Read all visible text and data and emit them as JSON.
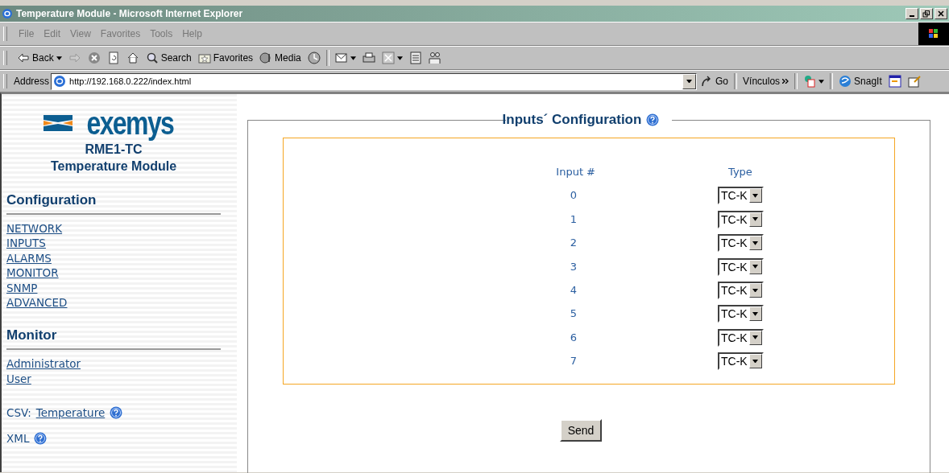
{
  "window": {
    "title": "Temperature Module - Microsoft Internet Explorer"
  },
  "menu": [
    "File",
    "Edit",
    "View",
    "Favorites",
    "Tools",
    "Help"
  ],
  "toolbar": [
    {
      "kind": "back",
      "label": "Back"
    },
    {
      "kind": "forward"
    },
    {
      "kind": "stop"
    },
    {
      "kind": "refresh"
    },
    {
      "kind": "home"
    },
    {
      "kind": "search",
      "label": "Search"
    },
    {
      "kind": "favorites",
      "label": "Favorites"
    },
    {
      "kind": "media",
      "label": "Media"
    },
    {
      "kind": "history"
    }
  ],
  "address_bar": {
    "label": "Address",
    "value": "http://192.168.0.222/index.html",
    "go": "Go",
    "links": "Vínculos",
    "snagit": "SnagIt"
  },
  "sidebar": {
    "logo": "exemys",
    "model": "RME1-TC",
    "subtitle": "Temperature Module",
    "sections": [
      {
        "title": "Configuration",
        "links": [
          "NETWORK",
          "INPUTS",
          "ALARMS",
          "MONITOR",
          "SNMP",
          "ADVANCED"
        ]
      },
      {
        "title": "Monitor",
        "links": [
          "Administrator",
          "User"
        ]
      }
    ],
    "exports": [
      {
        "label": "CSV:",
        "link": "Temperature"
      },
      {
        "label": "XML"
      }
    ]
  },
  "panel": {
    "title": "Inputs´ Configuration",
    "columns": [
      "Input #",
      "Type"
    ],
    "rows": [
      {
        "input": "0",
        "type": "TC-K"
      },
      {
        "input": "1",
        "type": "TC-K"
      },
      {
        "input": "2",
        "type": "TC-K"
      },
      {
        "input": "3",
        "type": "TC-K"
      },
      {
        "input": "4",
        "type": "TC-K"
      },
      {
        "input": "5",
        "type": "TC-K"
      },
      {
        "input": "6",
        "type": "TC-K"
      },
      {
        "input": "7",
        "type": "TC-K"
      }
    ],
    "button": "Send"
  }
}
